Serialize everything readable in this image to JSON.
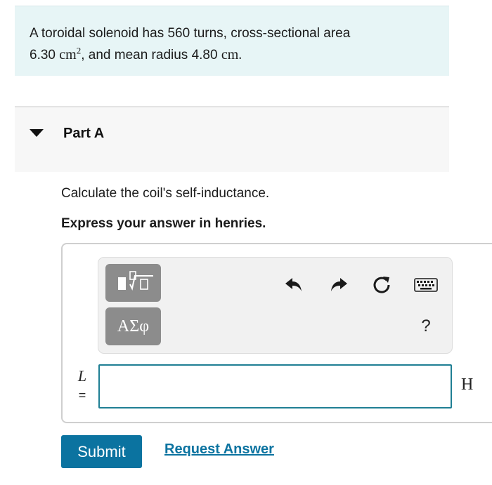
{
  "problem": {
    "text_1": "A toroidal solenoid has 560 turns, cross-sectional area",
    "area_value": "6.30 ",
    "area_unit": "cm",
    "area_exp": "2",
    "text_2": ", and mean radius 4.80 ",
    "radius_unit": "cm",
    "period": "."
  },
  "part": {
    "title": "Part A",
    "question": "Calculate the coil's self-inductance.",
    "instruction": "Express your answer in henries."
  },
  "toolbar": {
    "symbols_label": "ΑΣφ",
    "help_label": "?",
    "icons": [
      "templates-icon",
      "undo-icon",
      "redo-icon",
      "reset-icon",
      "keyboard-icon"
    ]
  },
  "answer": {
    "variable": "L",
    "equals": "=",
    "value": "",
    "unit": "H"
  },
  "actions": {
    "submit_label": "Submit",
    "request_label": "Request Answer"
  },
  "colors": {
    "problem_bg": "#e7f5f6",
    "accent": "#0b73a0",
    "input_border": "#1f7f94",
    "tool_button": "#8c8c8c"
  }
}
